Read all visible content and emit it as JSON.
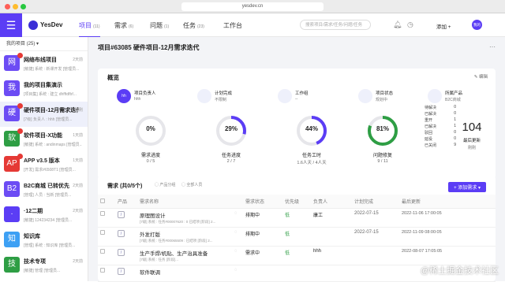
{
  "browser": {
    "url": "yesdev.cn"
  },
  "nav": {
    "logo": "YesDev",
    "tabs": [
      {
        "label": "项目",
        "count": "(11)",
        "active": true
      },
      {
        "label": "需求",
        "count": "(6)"
      },
      {
        "label": "问题",
        "count": "(1)"
      },
      {
        "label": "任务",
        "count": "(23)"
      },
      {
        "label": "工作台",
        "count": ""
      }
    ],
    "search_placeholder": "搜索项目/需求/任务/问题/任务",
    "add_label": "添加 +",
    "avatar_label": "我的"
  },
  "sidebar": {
    "filter_label": "我的项目 (25) ▾",
    "items": [
      {
        "avatar": "网",
        "color": "#6c4cf4",
        "name": "网络布线项目",
        "sub": "[敏捷] 系统 : 新课开发 [管理员...",
        "time": "2天前",
        "badge": true
      },
      {
        "avatar": "我",
        "color": "#6c4cf4",
        "name": "我的项目集演示",
        "sub": "[项目集] 系统 : 建立 dhfftdfbf...",
        "time": "",
        "badge": false
      },
      {
        "avatar": "硬",
        "color": "#6c4cf4",
        "name": "硬件项目-12月需求迭代",
        "sub": "[7级] 负责人 : hhh [管理员...",
        "time": "刚刚",
        "badge": true,
        "active": true
      },
      {
        "avatar": "软",
        "color": "#2e9e44",
        "name": "软件项目-X功能",
        "sub": "[敏捷] 系统 : andinmaps [管理员...",
        "time": "1天前",
        "badge": true
      },
      {
        "avatar": "AP",
        "color": "#e53935",
        "name": "APP v3.5 版本",
        "sub": "[开发] 需求#6508T1 [管理员...",
        "time": "1天前",
        "badge": true
      },
      {
        "avatar": "B2",
        "color": "#6c4cf4",
        "name": "B2C商城 已转优先",
        "sub": "[管理] 人员 : 当新 [管理员...",
        "time": "2天前",
        "badge": false
      },
      {
        "avatar": "·",
        "color": "#5b3df5",
        "name": "·12二期",
        "sub": "[敏捷] 124234234 [管理员...",
        "time": "2天前",
        "badge": false
      },
      {
        "avatar": "知",
        "color": "#3da0f4",
        "name": "知识库",
        "sub": "[管理] 系统 : 知识库 [管理员...",
        "time": "",
        "badge": false
      },
      {
        "avatar": "技",
        "color": "#2e9e44",
        "name": "技术专项",
        "sub": "[敏捷] 管理 [管理员...",
        "time": "2天前",
        "badge": false
      }
    ]
  },
  "main": {
    "title": "项目#63085 硬件项目-12月需求迭代",
    "overview_title": "概览",
    "edit_label": "编辑",
    "meta": [
      {
        "label": "项目负责人",
        "value": "hhh",
        "color": "#5b3df5",
        "icon": "hh"
      },
      {
        "label": "计划完成",
        "value": "不限制",
        "color": "#eef0fb",
        "icon": ""
      },
      {
        "label": "工作组",
        "value": "--",
        "color": "#eef0fb",
        "icon": ""
      },
      {
        "label": "项目状态",
        "value": "规划中",
        "color": "#eef0fb",
        "icon": ""
      },
      {
        "label": "所属产品",
        "value": "B2C商城",
        "color": "#eef0fb",
        "icon": ""
      }
    ],
    "stats": [
      {
        "pct": "0%",
        "fraction": 0.0,
        "color": "#999",
        "label": "需求进度",
        "value": "0 / 5"
      },
      {
        "pct": "29%",
        "fraction": 0.29,
        "color": "#5b3df5",
        "label": "任务进度",
        "value": "2 / 7"
      },
      {
        "pct": "44%",
        "fraction": 0.44,
        "color": "#5b3df5",
        "label": "任务工时",
        "value": "1.6人天 / 4人天"
      },
      {
        "pct": "81%",
        "fraction": 0.81,
        "color": "#2e9e44",
        "label": "问题修复",
        "value": "9 / 11"
      }
    ],
    "task_status": [
      {
        "label": "待解决",
        "value": "0"
      },
      {
        "label": "已解决",
        "value": "0"
      },
      {
        "label": "重开",
        "value": "1"
      },
      {
        "label": "已解决",
        "value": "1"
      },
      {
        "label": "驳回",
        "value": "0"
      },
      {
        "label": "延役",
        "value": "0"
      },
      {
        "label": "已关闭",
        "value": "9"
      }
    ],
    "big_number": "104",
    "big_label": "最后更新",
    "big_sub": "刚刚",
    "req": {
      "title": "需求 (共0/5个)",
      "filter1": "产品分组",
      "filter2": "全部人员",
      "add_button": "+ 添加需求 ▾",
      "headers": [
        "",
        "产品",
        "需求名称",
        "",
        "需求状态",
        "优先级",
        "负责人",
        "计划完成",
        "最后更新"
      ],
      "rows": [
        {
          "title": "原理图设计",
          "sub": "[7级] 系统 : 任务#00007620 : 0 已结项 [阶段] 2...",
          "status": "排期中",
          "priority": "低",
          "owner": "康工",
          "plan": "2022-07-15",
          "updated": "2022-11-06 17:00:05"
        },
        {
          "title": "外发打版",
          "sub": "[7级] 系统 : 任务#00065509 : 已结项 [阶段] 2...",
          "status": "排期中",
          "priority": "低",
          "owner": "",
          "plan": "2022-07-15",
          "updated": "2022-11-09 08:00:05"
        },
        {
          "title": "生产手焊/机贴、生产治具准备",
          "sub": "[7级] 系统 : 任务 [阶段]...",
          "status": "需求中",
          "priority": "低",
          "owner": "hhh",
          "plan": "",
          "updated": "2022-08-07 17:05:05"
        },
        {
          "title": "软件联调",
          "sub": "",
          "status": "",
          "priority": "",
          "owner": "",
          "plan": "",
          "updated": ""
        }
      ]
    }
  },
  "watermark": "@稀土掘金技术社区"
}
